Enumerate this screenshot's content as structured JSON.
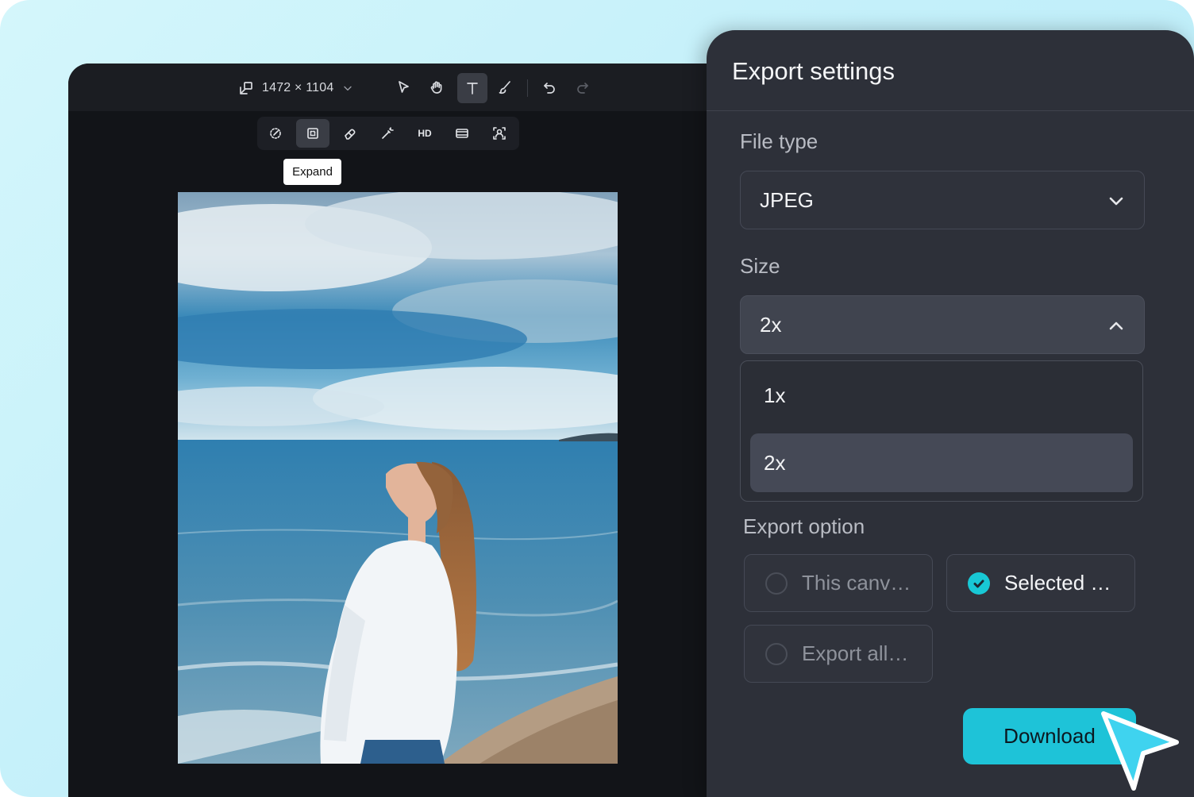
{
  "editor": {
    "canvas_size": "1472 × 1104",
    "tooltip": "Expand",
    "hd_label": "HD",
    "tools": [
      "resize-icon",
      "select-arrow-icon",
      "hand-icon",
      "text-icon",
      "brush-icon",
      "undo-icon",
      "redo-icon"
    ],
    "subtools": [
      "magic-remove-icon",
      "expand-icon",
      "eraser-icon",
      "magic-wand-icon",
      "hd-icon",
      "hd-video-icon",
      "portrait-icon"
    ]
  },
  "export": {
    "title": "Export settings",
    "file_type_label": "File type",
    "file_type_value": "JPEG",
    "size_label": "Size",
    "size_value": "2x",
    "size_options": [
      "1x",
      "2x"
    ],
    "export_option_label": "Export option",
    "options": [
      "This canv…",
      "Selected …",
      "Export all…"
    ],
    "selected_option": "Selected …",
    "download_label": "Download",
    "accent_color": "#1ec3d8"
  }
}
